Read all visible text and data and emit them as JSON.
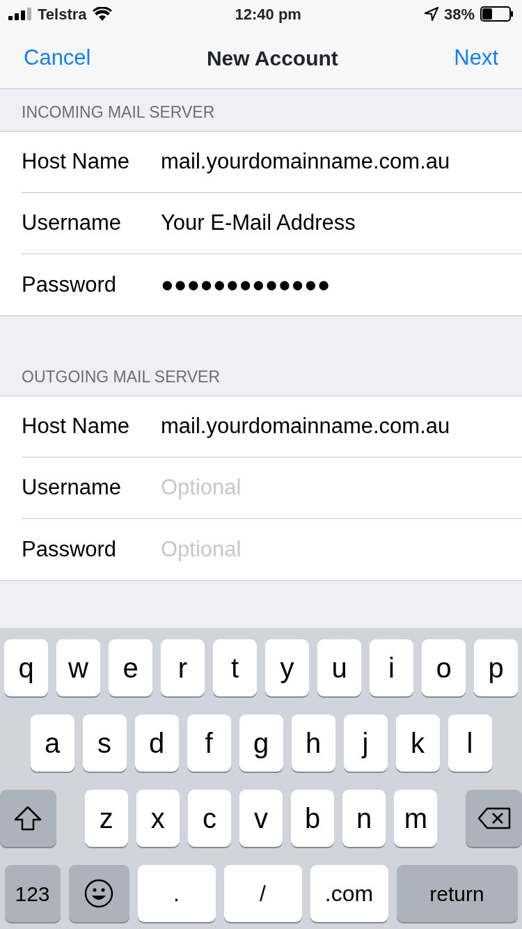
{
  "status_bar": {
    "carrier": "Telstra",
    "time": "12:40 pm",
    "battery": "38%"
  },
  "nav": {
    "cancel": "Cancel",
    "title": "New Account",
    "next": "Next"
  },
  "sections": [
    {
      "header": "INCOMING MAIL SERVER",
      "rows": [
        {
          "label": "Host Name",
          "value": "mail.yourdomainname.com.au"
        },
        {
          "label": "Username",
          "value": "Your E-Mail Address"
        },
        {
          "label": "Password",
          "value": "●●●●●●●●●●●●●"
        }
      ]
    },
    {
      "header": "OUTGOING MAIL SERVER",
      "rows": [
        {
          "label": "Host Name",
          "value": "mail.yourdomainname.com.au"
        },
        {
          "label": "Username",
          "placeholder": "Optional"
        },
        {
          "label": "Password",
          "placeholder": "Optional"
        }
      ]
    }
  ],
  "keyboard": {
    "rows": [
      {
        "keys": [
          {
            "kind": "letter",
            "label": "q"
          },
          {
            "kind": "letter",
            "label": "w"
          },
          {
            "kind": "letter",
            "label": "e"
          },
          {
            "kind": "letter",
            "label": "r"
          },
          {
            "kind": "letter",
            "label": "t"
          },
          {
            "kind": "letter",
            "label": "y"
          },
          {
            "kind": "letter",
            "label": "u"
          },
          {
            "kind": "letter",
            "label": "i"
          },
          {
            "kind": "letter",
            "label": "o"
          },
          {
            "kind": "letter",
            "label": "p"
          }
        ]
      },
      {
        "keys": [
          {
            "kind": "letter",
            "label": "a"
          },
          {
            "kind": "letter",
            "label": "s"
          },
          {
            "kind": "letter",
            "label": "d"
          },
          {
            "kind": "letter",
            "label": "f"
          },
          {
            "kind": "letter",
            "label": "g"
          },
          {
            "kind": "letter",
            "label": "h"
          },
          {
            "kind": "letter",
            "label": "j"
          },
          {
            "kind": "letter",
            "label": "k"
          },
          {
            "kind": "letter",
            "label": "l"
          }
        ]
      },
      {
        "keys": [
          {
            "kind": "shift"
          },
          {
            "kind": "letter",
            "label": "z"
          },
          {
            "kind": "letter",
            "label": "x"
          },
          {
            "kind": "letter",
            "label": "c"
          },
          {
            "kind": "letter",
            "label": "v"
          },
          {
            "kind": "letter",
            "label": "b"
          },
          {
            "kind": "letter",
            "label": "n"
          },
          {
            "kind": "letter",
            "label": "m"
          },
          {
            "kind": "delete"
          }
        ]
      },
      {
        "keys": [
          {
            "kind": "mode",
            "label": "123"
          },
          {
            "kind": "emoji"
          },
          {
            "kind": "wide",
            "label": "."
          },
          {
            "kind": "wide",
            "label": "/"
          },
          {
            "kind": "wide",
            "label": ".com"
          },
          {
            "kind": "return",
            "label": "return"
          }
        ]
      }
    ]
  }
}
